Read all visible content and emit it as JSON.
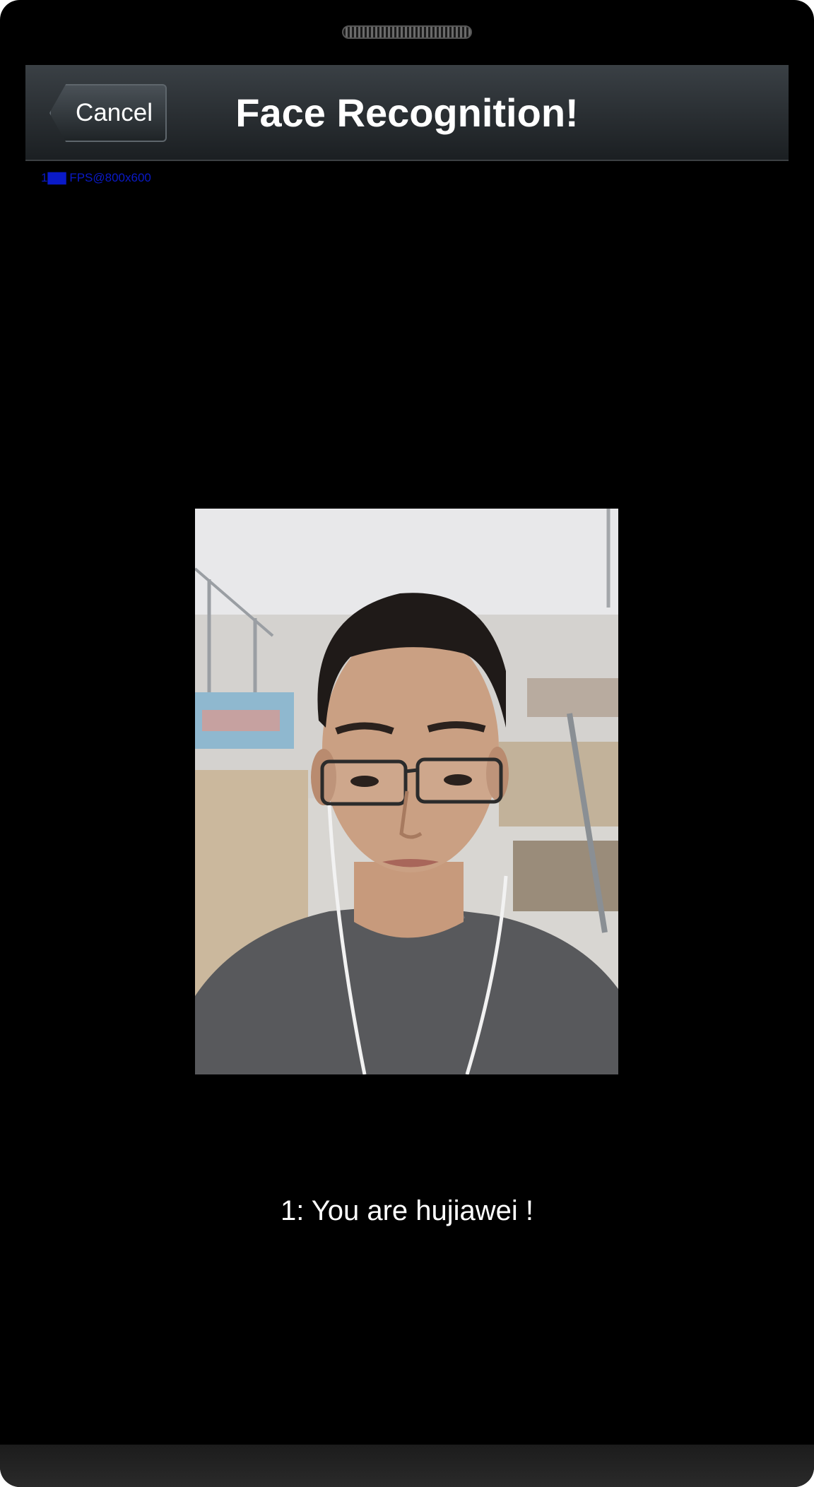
{
  "header": {
    "cancel_label": "Cancel",
    "title": "Face Recognition!"
  },
  "overlay": {
    "fps_text": "1▇▇ FPS@800x600"
  },
  "camera": {
    "icon": "camera-preview"
  },
  "result": {
    "text": "1: You are hujiawei !"
  },
  "colors": {
    "background": "#000000",
    "titlebar": "#2a2f33",
    "fps_text": "#0a1ac8",
    "text": "#ffffff"
  }
}
